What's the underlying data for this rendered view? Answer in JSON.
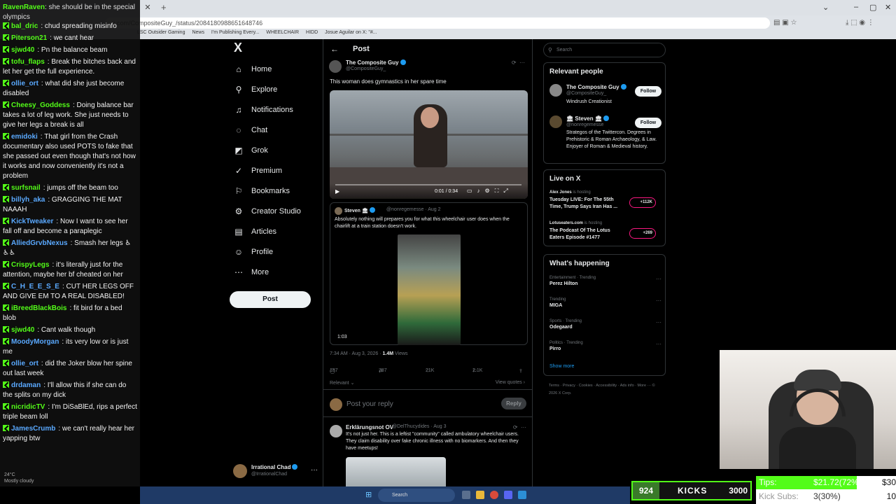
{
  "browser": {
    "url": "x.com/CompositeGuy_/status/2084180988651648746",
    "bookmarks": [
      "LSC Outsider Gaming",
      "News",
      "I'm Publishing Every...",
      "WHEELCHAIR",
      "HIDD",
      "Josue Aguilar on X: \"#..."
    ]
  },
  "chat": {
    "header_user": "RavenRaven",
    "header_text": "she should be in the special olympics",
    "messages": [
      {
        "user": "bal_dric",
        "color": "#53fc18",
        "text": "chud spreading misinfo"
      },
      {
        "user": "Piterson21",
        "color": "#53fc18",
        "text": "we cant hear"
      },
      {
        "user": "sjwd40",
        "color": "#53fc18",
        "text": "Pn the balance beam"
      },
      {
        "user": "tofu_flaps",
        "color": "#53fc18",
        "text": "Break the bitches back and let her get the full experience."
      },
      {
        "user": "ollie_ort",
        "color": "#5aa9ff",
        "text": "what did she just become disabled"
      },
      {
        "user": "Cheesy_Goddess",
        "color": "#53fc18",
        "text": "Doing balance bar takes a lot of leg work. She just needs to give her legs a break is all"
      },
      {
        "user": "emidoki",
        "color": "#5aa9ff",
        "text": "That girl from the Crash documentary also used POTS to fake that she passed out even though that's not how it works and now conveniently it's not a problem"
      },
      {
        "user": "surfsnail",
        "color": "#53fc18",
        "text": "jumps off the beam too"
      },
      {
        "user": "billyh_aka",
        "color": "#5aa9ff",
        "text": "GRAGGING THE MAT NAAAH"
      },
      {
        "user": "KickTweaker",
        "color": "#5aa9ff",
        "text": "Now I want to see her fall off and become a paraplegic"
      },
      {
        "user": "AlliedGrvbNexus",
        "color": "#5aa9ff",
        "text": "Smash her legs ♿♿♿"
      },
      {
        "user": "CrispyLegs",
        "color": "#53fc18",
        "text": "it's literally just for the attention, maybe her bf cheated on her"
      },
      {
        "user": "C_H_E_E_S_E",
        "color": "#5aa9ff",
        "text": "CUT HER LEGS OFF AND GIVE EM TO A REAL DISABLED!"
      },
      {
        "user": "iBreedBlackBois",
        "color": "#53fc18",
        "text": "fit bird for a bed blob"
      },
      {
        "user": "sjwd40",
        "color": "#53fc18",
        "text": "Cant walk though"
      },
      {
        "user": "MoodyMorgan",
        "color": "#5aa9ff",
        "text": "its very low or is just me"
      },
      {
        "user": "ollie_ort",
        "color": "#5aa9ff",
        "text": "did the Joker blow her spine out last week"
      },
      {
        "user": "drdaman",
        "color": "#5aa9ff",
        "text": "I'll allow this if she can do the splits on my dick"
      },
      {
        "user": "nicridicTV",
        "color": "#53fc18",
        "text": "I'm DiSaBlEd, rips a perfect triple beam loll"
      },
      {
        "user": "JamesCrumb",
        "color": "#5aa9ff",
        "text": "we can't really hear her yapping btw"
      }
    ],
    "weather_temp": "24°C",
    "weather_desc": "Mostly cloudy"
  },
  "nav": {
    "logo": "X",
    "items": [
      {
        "label": "Home",
        "icon": "home-icon",
        "glyph": "⌂"
      },
      {
        "label": "Explore",
        "icon": "search-icon",
        "glyph": "⚲"
      },
      {
        "label": "Notifications",
        "icon": "bell-icon",
        "glyph": "♫"
      },
      {
        "label": "Chat",
        "icon": "chat-icon",
        "glyph": "◌"
      },
      {
        "label": "Grok",
        "icon": "grok-icon",
        "glyph": "◩"
      },
      {
        "label": "Premium",
        "icon": "premium-icon",
        "glyph": "✓"
      },
      {
        "label": "Bookmarks",
        "icon": "bookmark-icon",
        "glyph": "⚐"
      },
      {
        "label": "Creator Studio",
        "icon": "studio-icon",
        "glyph": "⚙"
      },
      {
        "label": "Articles",
        "icon": "articles-icon",
        "glyph": "▤"
      },
      {
        "label": "Profile",
        "icon": "profile-icon",
        "glyph": "☺"
      },
      {
        "label": "More",
        "icon": "more-icon",
        "glyph": "⋯"
      }
    ],
    "post_label": "Post",
    "account_name": "Irrational Chad",
    "account_handle": "@IrrationalChad"
  },
  "post": {
    "header": "Post",
    "author": "The Composite Guy",
    "handle": "@CompositeGuy_",
    "text": "This woman does gymnastics in her spare time",
    "video_time": "0:01 / 0:34",
    "quote": {
      "author": "Steven 🏛",
      "meta": "@nonregemesse · Aug 2",
      "text": "Absolutely nothing will prepares you for what this wheelchair user does when the chairlift at a train station doesn't work.",
      "duration": "1:03"
    },
    "timestamp": "7:34 AM · Aug 3, 2026 · ",
    "views": "1.4M",
    "views_label": " Views",
    "replies": "187",
    "reposts": "787",
    "likes": "21K",
    "bookmarks": "2.1K",
    "relevant": "Relevant",
    "view_quotes": "View quotes",
    "reply_placeholder": "Post your reply",
    "reply_button": "Reply",
    "reply_post": {
      "author": "Erklärungsnot OV",
      "meta": "@DelThucydides · Aug 3",
      "text": "It's not just her. This is a leftist \"community\" called ambulatory wheelchair users. They claim disability over fake chronic illness with no biomarkers. And then they have meetups!"
    }
  },
  "right": {
    "search_placeholder": "Search",
    "relevant_title": "Relevant people",
    "people": [
      {
        "name": "The Composite Guy",
        "handle": "@CompositeGuy_",
        "bio": "Windrush Creationist",
        "follow": "Follow"
      },
      {
        "name": "🏛 Steven 🏛",
        "handle": "@nonregemesse",
        "bio": "Strategos of the Twittercon. Degrees in Prehistoric & Roman Archaeology, & Law. Enjoyer of Roman & Medieval history.",
        "follow": "Follow"
      }
    ],
    "live_title": "Live on X",
    "live": [
      {
        "host": "Alex Jones",
        "hosting": " is hosting",
        "title": "Tuesday LIVE: For The 55th Time, Trump Says Iran Has ...",
        "count": "+112K"
      },
      {
        "host": "Lotuseaters.com",
        "hosting": " is hosting",
        "title": "The Podcast Of The Lotus Eaters Episode #1477",
        "count": "+269"
      }
    ],
    "happening_title": "What's happening",
    "trends": [
      {
        "category": "Entertainment · Trending",
        "name": "Perez Hilton"
      },
      {
        "category": "Trending",
        "name": "MIGA"
      },
      {
        "category": "Sports · Trending",
        "name": "Odegaard"
      },
      {
        "category": "Politics · Trending",
        "name": "Pirro"
      }
    ],
    "show_more": "Show more",
    "footer": "Terms · Privacy · Cookies · Accessibility · Ads info · More ··· © 2026 X Corp."
  },
  "overlay": {
    "kicks_low": "924",
    "kicks_label": "KICKS",
    "kicks_goal": "3000",
    "tips_label": "Tips:",
    "tips_value": "$21.72(72%)",
    "tips_goal": "$30",
    "tips_progress": 0.72,
    "subs_label": "Kick Subs:",
    "subs_value": "3(30%)",
    "subs_goal": "10"
  },
  "taskbar": {
    "search": "Search"
  },
  "colors": {
    "kick_green": "#53fc18",
    "x_blue": "#1d9bf0",
    "live_pink": "#f91880"
  }
}
